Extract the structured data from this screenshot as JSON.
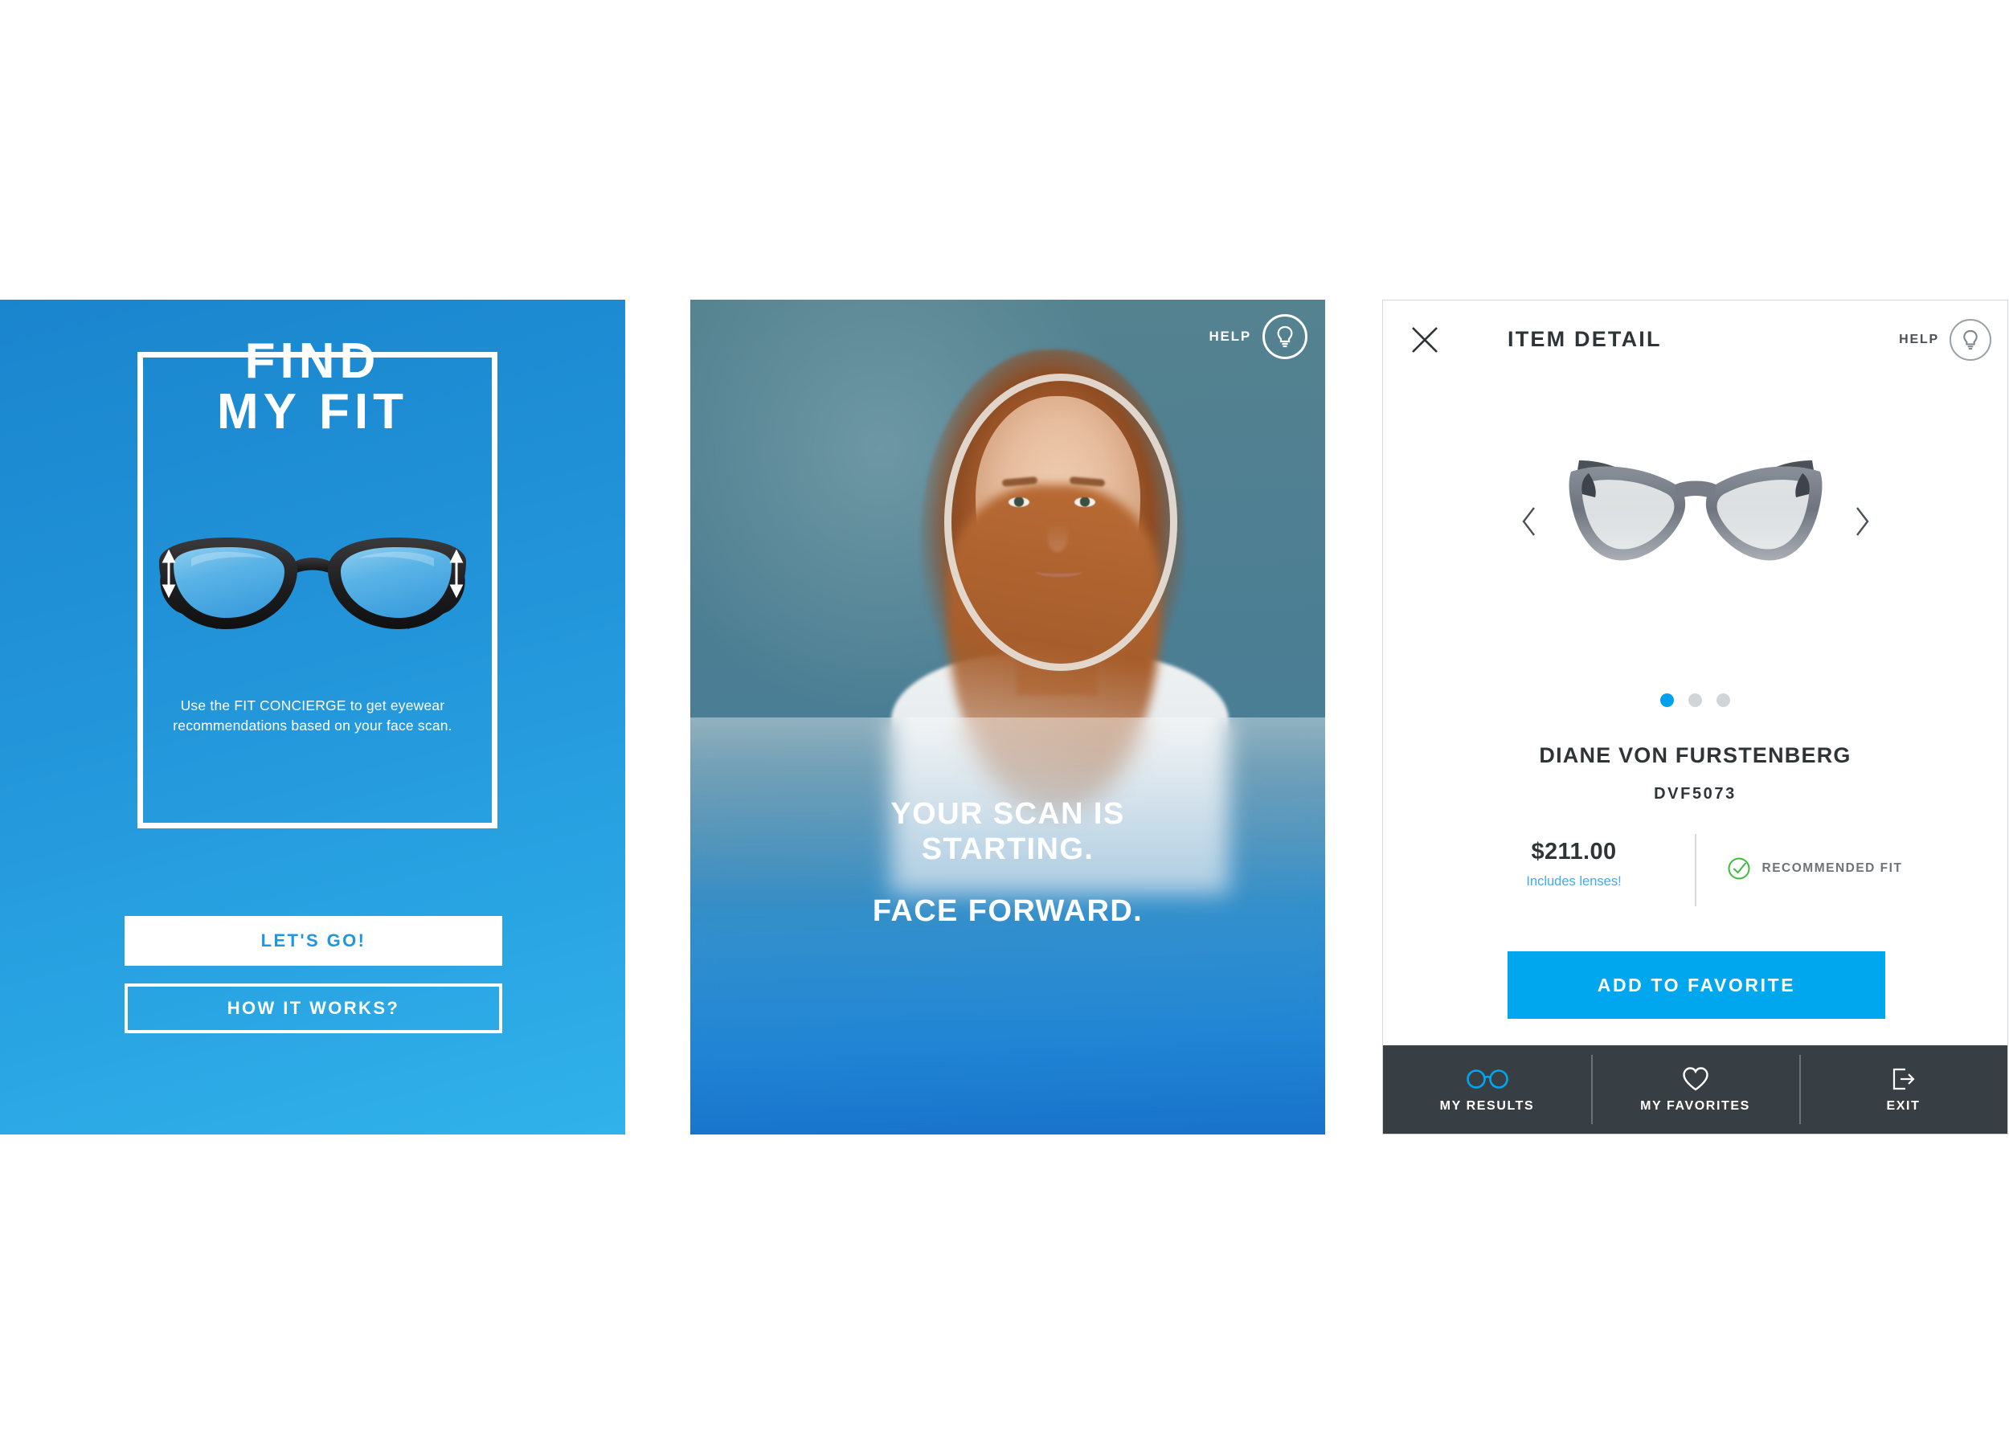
{
  "panel1": {
    "name": "find-my-fit-intro",
    "title_line1": "FIND",
    "title_line2": "MY FIT",
    "subtitle": "Use the FIT CONCIERGE to get eyewear recommendations based on your face scan.",
    "primary_button": "LET'S GO!",
    "secondary_button": "HOW IT WORKS?",
    "colors": {
      "bg_top": "#1a85ce",
      "bg_bottom": "#31b2ea",
      "accent_text": "#2196e0"
    }
  },
  "panel2": {
    "name": "face-scan-screen",
    "help_label": "HELP",
    "help_icon": "lightbulb-icon",
    "message_line1": "YOUR SCAN IS",
    "message_line2": "STARTING.",
    "message_line3": "FACE FORWARD.",
    "face_guide_shape": "oval-guide"
  },
  "panel3": {
    "name": "item-detail-screen",
    "close_icon": "close-icon",
    "title": "ITEM DETAIL",
    "help_label": "HELP",
    "help_icon": "lightbulb-icon",
    "carousel": {
      "prev_icon": "chevron-left-icon",
      "next_icon": "chevron-right-icon",
      "product_image": "eyeglasses-front-view",
      "dots": 3,
      "active_dot": 1
    },
    "brand": "DIANE VON FURSTENBERG",
    "model": "DVF5073",
    "price": "$211.00",
    "price_note": "Includes lenses!",
    "fit_badge": "RECOMMENDED FIT",
    "fit_badge_icon": "check-circle-icon",
    "fit_badge_color": "#3dbb3d",
    "cta_button": "ADD TO FAVORITE",
    "cta_color": "#00a7ee",
    "footer": {
      "items": [
        {
          "label": "MY RESULTS",
          "icon": "glasses-icon",
          "active": true
        },
        {
          "label": "MY FAVORITES",
          "icon": "heart-icon",
          "active": false
        },
        {
          "label": "EXIT",
          "icon": "exit-icon",
          "active": false
        }
      ]
    }
  }
}
